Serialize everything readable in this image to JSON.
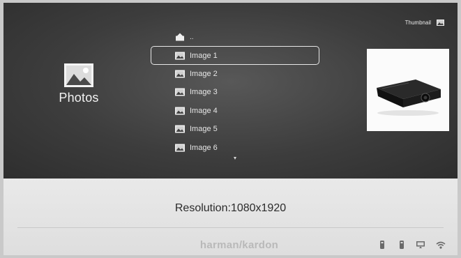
{
  "category": {
    "label": "Photos",
    "icon": "photo-icon"
  },
  "view_toggle": {
    "label": "Thumbnail",
    "icon": "photo-icon"
  },
  "file_list": {
    "parent": {
      "label": "..",
      "icon": "folder-up-icon"
    },
    "items": [
      {
        "label": "Image 1",
        "icon": "photo-icon",
        "selected": true
      },
      {
        "label": "Image 2",
        "icon": "photo-icon",
        "selected": false
      },
      {
        "label": "Image 3",
        "icon": "photo-icon",
        "selected": false
      },
      {
        "label": "Image 4",
        "icon": "photo-icon",
        "selected": false
      },
      {
        "label": "Image 5",
        "icon": "photo-icon",
        "selected": false
      },
      {
        "label": "Image 6",
        "icon": "photo-icon",
        "selected": false
      }
    ],
    "more_indicator": "scroll-down-arrow-icon"
  },
  "preview": {
    "subject": "projector-image"
  },
  "info": {
    "resolution": "Resolution:1080x1920"
  },
  "footer": {
    "brand": "harman/kardon",
    "status_icons": [
      "usb-icon",
      "usb-icon",
      "display-icon",
      "wifi-icon"
    ]
  },
  "colors": {
    "top_panel": "#3d3d3d",
    "bottom_panel": "#e4e4e4",
    "text_light": "#e6e6e6",
    "text_dark": "#2b2b2b",
    "brand_text": "#b9b9b9"
  }
}
